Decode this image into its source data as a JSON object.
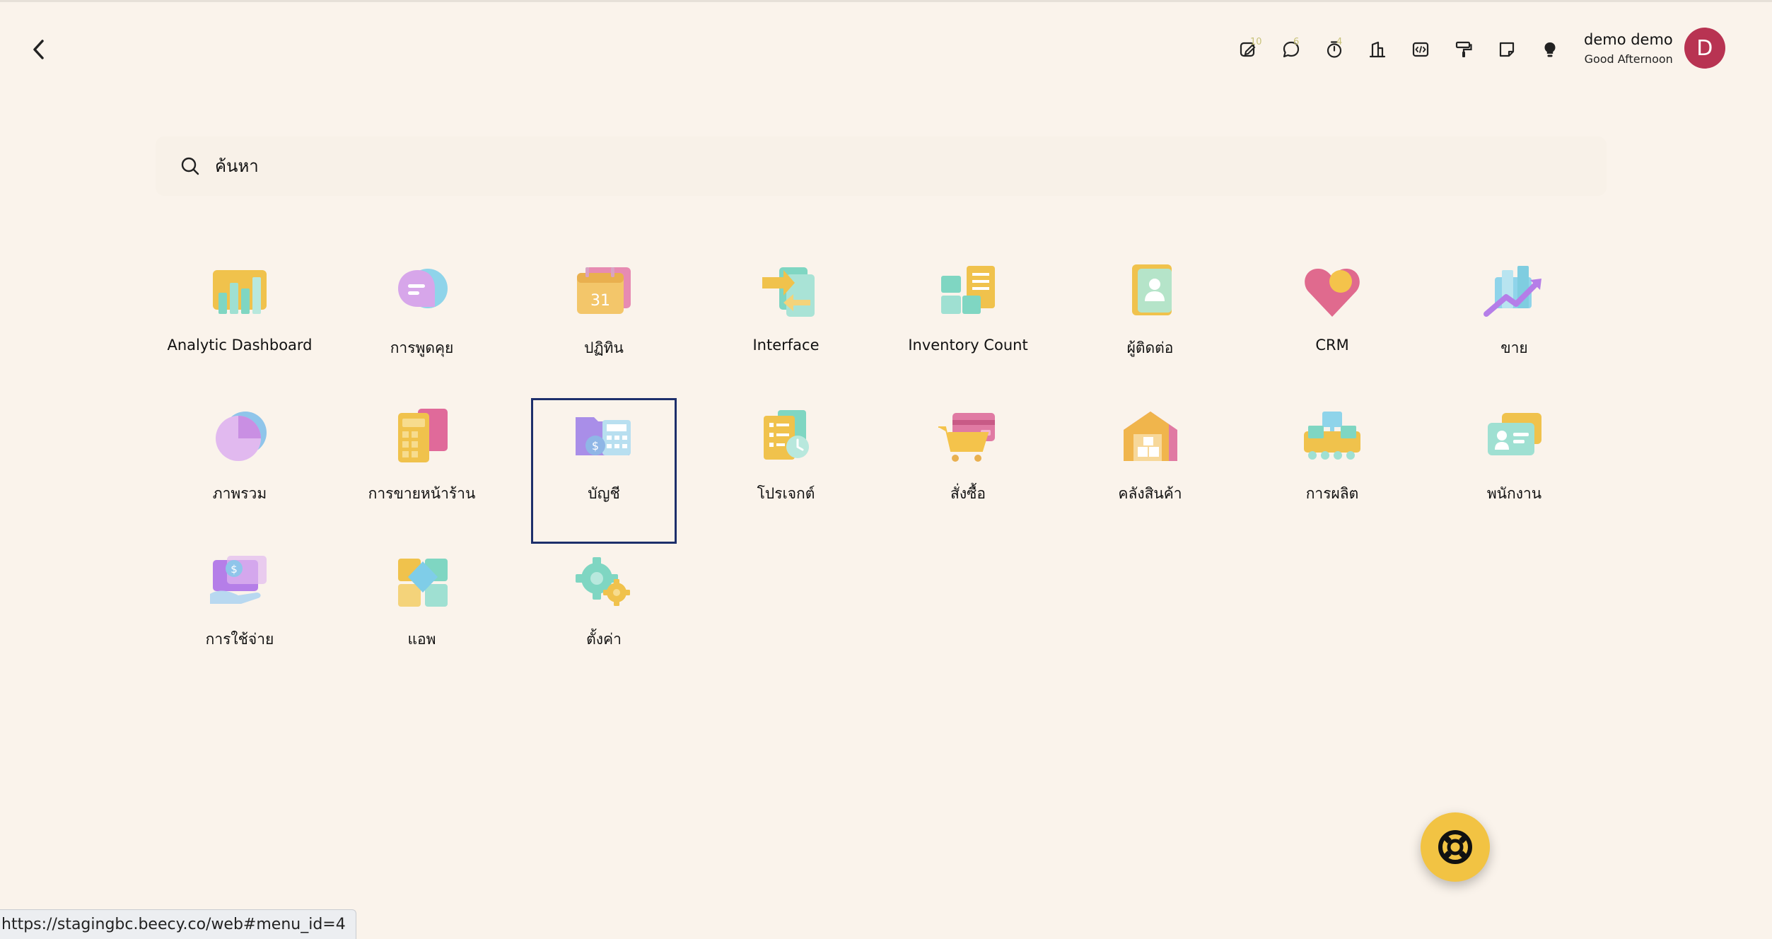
{
  "header": {
    "toolbar": [
      {
        "icon": "edit-note-icon",
        "badge": "10"
      },
      {
        "icon": "chat-bubble-icon",
        "badge": "6"
      },
      {
        "icon": "stopwatch-icon",
        "badge": "4"
      },
      {
        "icon": "building-icon",
        "badge": ""
      },
      {
        "icon": "code-window-icon",
        "badge": ""
      },
      {
        "icon": "paint-roller-icon",
        "badge": ""
      },
      {
        "icon": "sticky-note-icon",
        "badge": ""
      },
      {
        "icon": "lightbulb-icon",
        "badge": ""
      }
    ],
    "user": {
      "name": "demo demo",
      "greeting": "Good Afternoon",
      "avatar_letter": "D",
      "avatar_color": "#b83352"
    }
  },
  "search": {
    "placeholder": "ค้นหา"
  },
  "apps": [
    {
      "label": "Analytic Dashboard",
      "icon": "analytic-dashboard-icon"
    },
    {
      "label": "การพูดคุย",
      "icon": "chat-app-icon"
    },
    {
      "label": "ปฏิทิน",
      "icon": "calendar-app-icon"
    },
    {
      "label": "Interface",
      "icon": "interface-app-icon"
    },
    {
      "label": "Inventory Count",
      "icon": "inventory-count-icon"
    },
    {
      "label": "ผู้ติดต่อ",
      "icon": "contacts-app-icon"
    },
    {
      "label": "CRM",
      "icon": "crm-app-icon"
    },
    {
      "label": "ขาย",
      "icon": "sales-app-icon"
    },
    {
      "label": "ภาพรวม",
      "icon": "overview-app-icon"
    },
    {
      "label": "การขายหน้าร้าน",
      "icon": "pos-app-icon"
    },
    {
      "label": "บัญชี",
      "icon": "accounting-app-icon",
      "selected": true
    },
    {
      "label": "โปรเจกต์",
      "icon": "project-app-icon"
    },
    {
      "label": "สั่งซื้อ",
      "icon": "purchase-app-icon"
    },
    {
      "label": "คลังสินค้า",
      "icon": "inventory-app-icon"
    },
    {
      "label": "การผลิต",
      "icon": "manufacturing-app-icon"
    },
    {
      "label": "พนักงาน",
      "icon": "employees-app-icon"
    },
    {
      "label": "การใช้จ่าย",
      "icon": "expenses-app-icon"
    },
    {
      "label": "แอพ",
      "icon": "apps-app-icon"
    },
    {
      "label": "ตั้งค่า",
      "icon": "settings-app-icon"
    }
  ],
  "fab": {
    "icon": "lifebuoy-icon",
    "color": "#f2c343"
  },
  "status_url": "https://stagingbc.beecy.co/web#menu_id=4"
}
